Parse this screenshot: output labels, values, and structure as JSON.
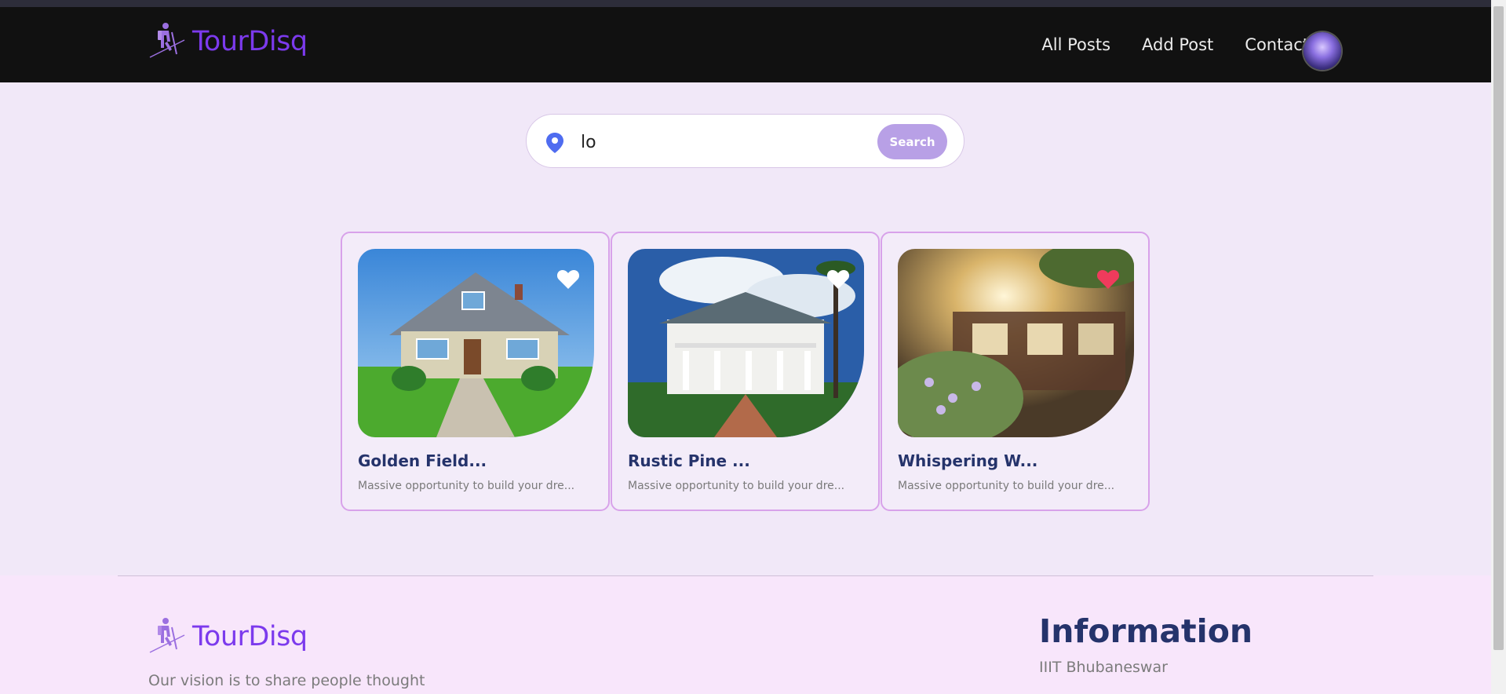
{
  "brand": {
    "name": "TourDisq",
    "color": "#7c3aed"
  },
  "nav": {
    "links": [
      {
        "label": "All Posts"
      },
      {
        "label": "Add Post"
      },
      {
        "label": "Contact"
      }
    ],
    "avatar_icon": "user-avatar"
  },
  "search": {
    "value": "lo",
    "placeholder": "",
    "button_label": "Search",
    "icon": "location-pin-icon"
  },
  "cards": [
    {
      "title": "Golden Field...",
      "description": "Massive opportunity to build your dre...",
      "favorited": false
    },
    {
      "title": "Rustic Pine ...",
      "description": "Massive opportunity to build your dre...",
      "favorited": false
    },
    {
      "title": "Whispering W...",
      "description": "Massive opportunity to build your dre...",
      "favorited": true
    }
  ],
  "footer": {
    "brand": "TourDisq",
    "tagline": "Our vision is to share people thought",
    "info_title": "Information",
    "info_line": "IIIT Bhubaneswar"
  },
  "colors": {
    "accent": "#7c3aed",
    "search_button": "#b8a0e6",
    "heart_active": "#ef3b5c",
    "heart_inactive": "#ffffff",
    "title_text": "#25336b"
  }
}
